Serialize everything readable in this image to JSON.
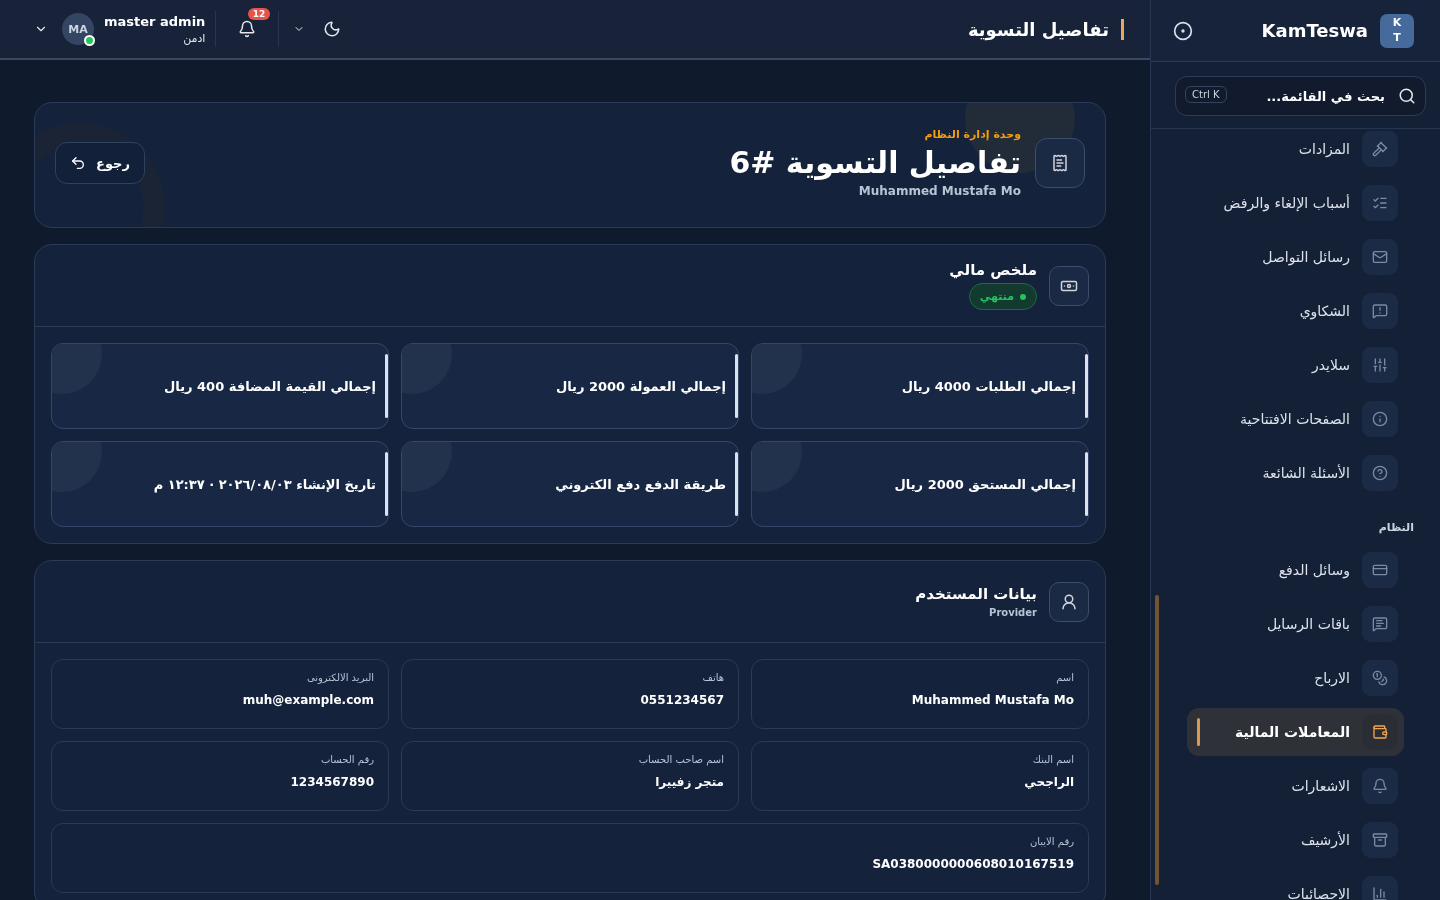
{
  "header": {
    "title": "تفاصيل التسوية",
    "notifications": "12",
    "user": {
      "name": "master admin",
      "role": "ادمن",
      "initials": "MA",
      "online": true
    }
  },
  "sidebar": {
    "brand": "KamTeswa",
    "logo": [
      "K",
      "T"
    ],
    "search": {
      "placeholder": "بحث في القائمة...",
      "shortcut": "Ctrl K"
    },
    "groups": [
      {
        "items": [
          {
            "label": "المزادات",
            "selected": false
          },
          {
            "label": "أسباب الإلغاء والرفض",
            "selected": false
          },
          {
            "label": "رسائل التواصل",
            "selected": false
          },
          {
            "label": "الشكاوي",
            "selected": false
          },
          {
            "label": "سلايدر",
            "selected": false
          },
          {
            "label": "الصفحات الافتتاحية",
            "selected": false
          },
          {
            "label": "الأسئلة الشائعة",
            "selected": false
          }
        ]
      },
      {
        "title": "النظام",
        "items": [
          {
            "label": "وسائل الدفع",
            "selected": false
          },
          {
            "label": "باقات الرسايل",
            "selected": false
          },
          {
            "label": "الارباح",
            "selected": false
          },
          {
            "label": "المعاملات المالية",
            "selected": true
          },
          {
            "label": "الاشعارات",
            "selected": false
          },
          {
            "label": "الأرشيف",
            "selected": false
          },
          {
            "label": "الاحصائيات",
            "selected": false
          }
        ]
      }
    ]
  },
  "hero": {
    "eyebrow": "وحدة إدارة النظام",
    "title": "تفاصيل التسوية #6",
    "subtitle": "Muhammed Mustafa Mo",
    "back": "رجوع"
  },
  "summary": {
    "title": "ملخص مالي",
    "status": "منتهي",
    "stats": [
      "إجمالي الطلبات **4000** ريال",
      "إجمالي العمولة **2000** ريال",
      "إجمالي القيمة المضافة **400** ريال",
      "إجمالي المستحق **2000** ريال",
      "طريقة الدفع **دفع الكتروني**",
      "تاريخ الإنشاء **٢٠٢٦/٠٨/٠٣ · ١٢:٣٧ م**"
    ]
  },
  "user_data": {
    "title": "بيانات المستخدم",
    "subtitle": "Provider",
    "fields": [
      {
        "label": "اسم",
        "value": "Muhammed Mustafa Mo"
      },
      {
        "label": "هاتف",
        "value": "0551234567"
      },
      {
        "label": "البريد الالكترونى",
        "value": "muh@example.com"
      },
      {
        "label": "اسم البنك",
        "value": "الراجحي"
      },
      {
        "label": "اسم صاحب الحساب",
        "value": "متجر زفييرا"
      },
      {
        "label": "رقم الحساب",
        "value": "1234567890"
      },
      {
        "label": "رقم الايبان",
        "value": "SA0380000000608010167519",
        "wide": true
      }
    ]
  }
}
